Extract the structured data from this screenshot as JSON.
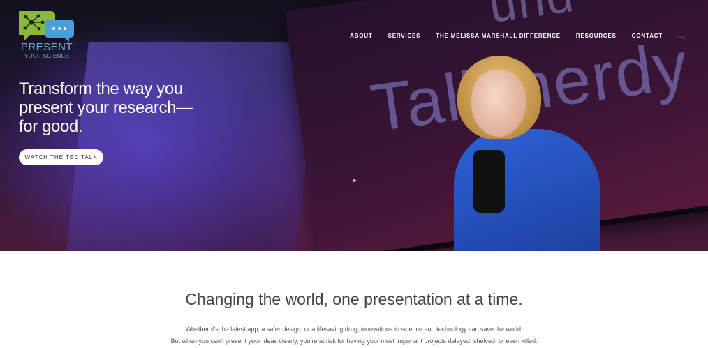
{
  "brand": {
    "line1": "PRESENT",
    "line2": "YOUR SCIENCE",
    "colors": {
      "green": "#8ab83a",
      "blue": "#4a9fd8",
      "text": "#6fb0d8"
    }
  },
  "nav": {
    "items": [
      {
        "label": "ABOUT"
      },
      {
        "label": "SERVICES"
      },
      {
        "label": "THE MELISSA MARSHALL DIFFERENCE"
      },
      {
        "label": "RESOURCES"
      },
      {
        "label": "CONTACT"
      }
    ],
    "partial_label": "..."
  },
  "hero": {
    "title": "Transform the way you present your research—for good.",
    "cta_label": "WATCH THE TED TALK",
    "backdrop_text_top": "und",
    "backdrop_text_main": "Talk nerdy",
    "play_glyph": "▶"
  },
  "intro": {
    "heading": "Changing the world, one presentation at a time.",
    "p1": "Whether it’s the latest app, a safer design, or a lifesaving drug, innovations in science and technology can save the world.",
    "p2": "But when you can’t present your ideas clearly, you’re at risk for having your most important projects delayed, shelved, or even killed."
  }
}
